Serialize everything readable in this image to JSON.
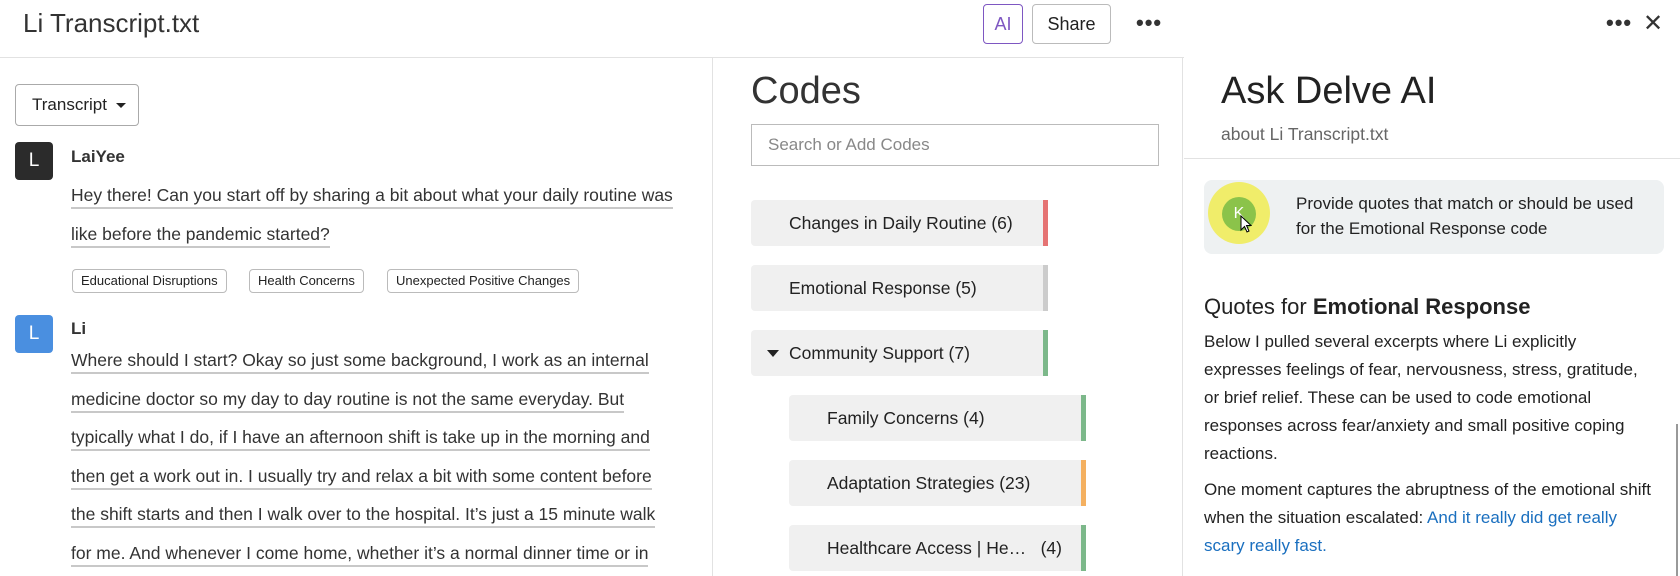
{
  "header": {
    "doc_title": "Li Transcript.txt",
    "ai_label": "AI",
    "share_label": "Share",
    "more_label": "•••"
  },
  "transcript": {
    "dropdown_label": "Transcript",
    "entries": [
      {
        "initial": "L",
        "avatar_color": "#2b2b2b",
        "speaker": "LaiYee",
        "lines": [
          "Hey there! Can you start off by sharing a bit about what your daily routine was",
          "like before the pandemic started?"
        ],
        "tags": [
          "Educational Disruptions",
          "Health Concerns",
          "Unexpected Positive Changes"
        ]
      },
      {
        "initial": "L",
        "avatar_color": "#4a8fe0",
        "speaker": "Li",
        "lines": [
          "Where should I start? Okay so just some background, I work as an internal",
          "medicine doctor so my day to day routine is not the same everyday. But",
          "typically what I do, if I have an afternoon shift is take up in the morning and",
          "then get a work out in. I usually try and relax a bit with some content before",
          "the shift starts and then I walk over to the hospital. It’s just a 15 minute walk",
          "for me. And whenever I come home, whether it’s a normal dinner time or in"
        ]
      }
    ]
  },
  "codes": {
    "title": "Codes",
    "search_placeholder": "Search or Add Codes",
    "items": [
      {
        "label": "Changes in Daily Routine (6)",
        "color": "#e57373"
      },
      {
        "label": "Emotional Response (5)",
        "color": "#cccccc"
      },
      {
        "label": "Community Support (7)",
        "color": "#7cb88a"
      },
      {
        "label": "Family Concerns (4)",
        "color": "#7cb88a"
      },
      {
        "label": "Adaptation Strategies (23)",
        "color": "#f4b060"
      },
      {
        "label": "Healthcare Access | He…",
        "count": "(4)",
        "color": "#7cb88a"
      }
    ]
  },
  "ai_panel": {
    "more_label": "•••",
    "close_label": "✕",
    "title": "Ask Delve AI",
    "subtitle": "about Li Transcript.txt",
    "user_initial": "K",
    "prompt": "Provide quotes that match or should be used for the Emotional Response code",
    "quotes_heading_prefix": "Quotes for ",
    "quotes_heading_bold": "Emotional Response",
    "paragraph1": "Below I pulled several excerpts where Li explicitly expresses feelings of fear, nervousness, stress, gratitude, or brief relief. These can be used to code emotional responses across fear/anxiety and small positive coping reactions.",
    "paragraph2_text": "One moment captures the abruptness of the emotional shift when the situation escalated: ",
    "paragraph2_link": "And it really did get really scary really fast."
  }
}
